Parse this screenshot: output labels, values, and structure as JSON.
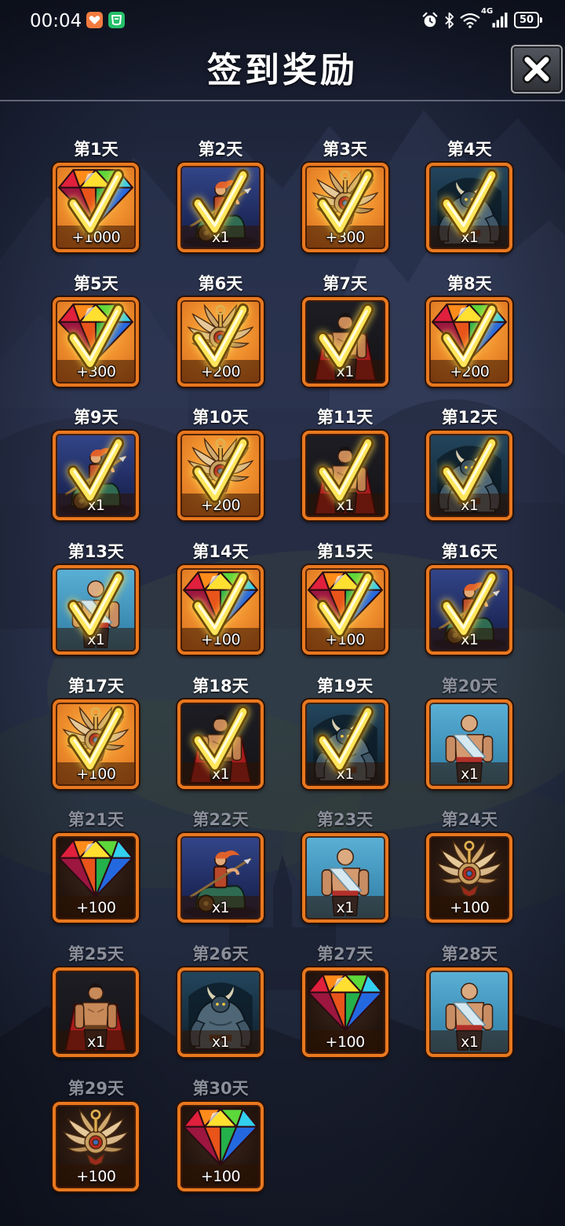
{
  "status_bar": {
    "time": "00:04",
    "network": "4G",
    "battery": "50",
    "app_icons": [
      "heart-app-icon",
      "green-app-icon"
    ],
    "system_icons": [
      "alarm-icon",
      "bluetooth-icon",
      "wifi-icon",
      "signal-icon",
      "battery-icon"
    ]
  },
  "header": {
    "title": "签到奖励",
    "close_icon": "close-icon"
  },
  "colors": {
    "card_border": "#e8781f",
    "claimed_label": "#ffffff",
    "unclaimed_label": "#8b8f9b",
    "check": "#ffe65a"
  },
  "rewards": [
    {
      "day": "第1天",
      "item": "gem-icon",
      "amount": "+1000",
      "claimed": true
    },
    {
      "day": "第2天",
      "item": "hero-rider-icon",
      "amount": "x1",
      "claimed": true
    },
    {
      "day": "第3天",
      "item": "badge-icon",
      "amount": "+300",
      "claimed": true
    },
    {
      "day": "第4天",
      "item": "hero-ogre-icon",
      "amount": "x1",
      "claimed": true
    },
    {
      "day": "第5天",
      "item": "gem-icon",
      "amount": "+300",
      "claimed": true
    },
    {
      "day": "第6天",
      "item": "badge-icon",
      "amount": "+200",
      "claimed": true
    },
    {
      "day": "第7天",
      "item": "hero-barbarian-icon",
      "amount": "x1",
      "claimed": true
    },
    {
      "day": "第8天",
      "item": "gem-icon",
      "amount": "+200",
      "claimed": true
    },
    {
      "day": "第9天",
      "item": "hero-rider-icon",
      "amount": "x1",
      "claimed": true
    },
    {
      "day": "第10天",
      "item": "badge-icon",
      "amount": "+200",
      "claimed": true
    },
    {
      "day": "第11天",
      "item": "hero-barbarian-icon",
      "amount": "x1",
      "claimed": true
    },
    {
      "day": "第12天",
      "item": "hero-ogre-icon",
      "amount": "x1",
      "claimed": true
    },
    {
      "day": "第13天",
      "item": "hero-monk-icon",
      "amount": "x1",
      "claimed": true
    },
    {
      "day": "第14天",
      "item": "gem-icon",
      "amount": "+100",
      "claimed": true
    },
    {
      "day": "第15天",
      "item": "gem-icon",
      "amount": "+100",
      "claimed": true
    },
    {
      "day": "第16天",
      "item": "hero-rider-icon",
      "amount": "x1",
      "claimed": true
    },
    {
      "day": "第17天",
      "item": "badge-icon",
      "amount": "+100",
      "claimed": true
    },
    {
      "day": "第18天",
      "item": "hero-barbarian-icon",
      "amount": "x1",
      "claimed": true
    },
    {
      "day": "第19天",
      "item": "hero-ogre-icon",
      "amount": "x1",
      "claimed": true
    },
    {
      "day": "第20天",
      "item": "hero-monk-icon",
      "amount": "x1",
      "claimed": false
    },
    {
      "day": "第21天",
      "item": "gem-icon",
      "amount": "+100",
      "claimed": false
    },
    {
      "day": "第22天",
      "item": "hero-rider-icon",
      "amount": "x1",
      "claimed": false
    },
    {
      "day": "第23天",
      "item": "hero-monk-icon",
      "amount": "x1",
      "claimed": false
    },
    {
      "day": "第24天",
      "item": "badge-icon",
      "amount": "+100",
      "claimed": false
    },
    {
      "day": "第25天",
      "item": "hero-barbarian-icon",
      "amount": "x1",
      "claimed": false
    },
    {
      "day": "第26天",
      "item": "hero-ogre-icon",
      "amount": "x1",
      "claimed": false
    },
    {
      "day": "第27天",
      "item": "gem-icon",
      "amount": "+100",
      "claimed": false
    },
    {
      "day": "第28天",
      "item": "hero-monk-icon",
      "amount": "x1",
      "claimed": false
    },
    {
      "day": "第29天",
      "item": "badge-icon",
      "amount": "+100",
      "claimed": false
    },
    {
      "day": "第30天",
      "item": "gem-icon",
      "amount": "+100",
      "claimed": false
    }
  ]
}
